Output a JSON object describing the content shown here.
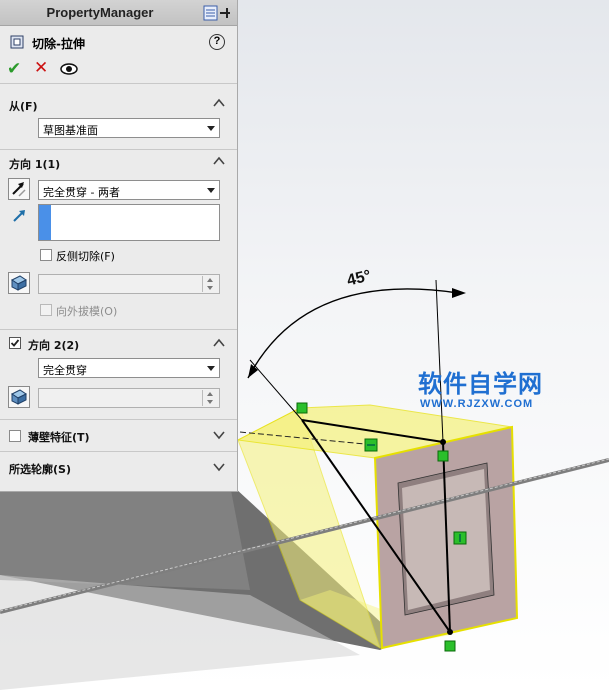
{
  "panel": {
    "header_title": "PropertyManager",
    "feature_title": "切除-拉伸",
    "help_glyph": "?",
    "ok_glyph": "✔",
    "cancel_glyph": "✕"
  },
  "from": {
    "title": "从(F)",
    "selected": "草图基准面"
  },
  "direction1": {
    "title": "方向 1(1)",
    "end_condition": "完全贯穿 - 两者",
    "selection_value": "",
    "flip_side_label": "反侧切除(F)",
    "flip_side_checked": false,
    "draft_value": "",
    "draft_outward_label": "向外拔模(O)",
    "draft_outward_checked": false
  },
  "direction2": {
    "title": "方向 2(2)",
    "checked": true,
    "end_condition": "完全贯穿",
    "draft_value": ""
  },
  "thin_feature": {
    "title": "薄壁特征(T)",
    "checked": false
  },
  "selected_contours": {
    "title": "所选轮廓(S)"
  },
  "viewport": {
    "dimension_label": "45°",
    "watermark_main": "软件自学网",
    "watermark_url": "WWW.RJZXW.COM"
  },
  "colors": {
    "panel_bg": "#ebebeb",
    "accent_blue": "#4a90e8",
    "ok_green": "#2b9a2b",
    "cancel_red": "#cc1111",
    "sketch_yellow": "#f5f17a",
    "face_brown": "#b9a3a3",
    "watermark_blue": "#1f6fd1"
  }
}
